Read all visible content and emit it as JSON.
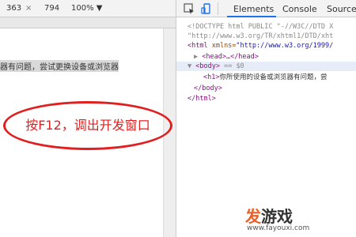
{
  "device_bar": {
    "width": "363",
    "separator": "×",
    "height": "794",
    "zoom": "100% ▼"
  },
  "page": {
    "heading_fragment": "器有问题，尝试更换设备或浏览器"
  },
  "annotation": {
    "text": "按F12，调出开发窗口",
    "color": "#e02020"
  },
  "devtools": {
    "tabs": {
      "elements": "Elements",
      "console": "Console",
      "sources": "Sources"
    },
    "active_tab_color": "#1a73e8",
    "dom": {
      "doctype": "<!DOCTYPE html PUBLIC \"-//W3C//DTD X",
      "doctype2": "\"http://www.w3.org/TR/xhtml1/DTD/xht",
      "html_open": "<html",
      "html_attr": " xmlns=",
      "html_val": "\"http://www.w3.org/1999/",
      "head": "<head>…</head>",
      "head_arrow": "▶",
      "body_arrow": "▼",
      "body_tag": "<body>",
      "body_marker": " == $0",
      "h1_tag": "<h1>",
      "h1_text": "你所使用的设备或浏览器有问题，尝",
      "body_close": "</body>",
      "html_close": "</html>"
    }
  },
  "watermark": {
    "logo_a": "发",
    "logo_b": "游戏",
    "url": "www.fayouxi.com"
  }
}
